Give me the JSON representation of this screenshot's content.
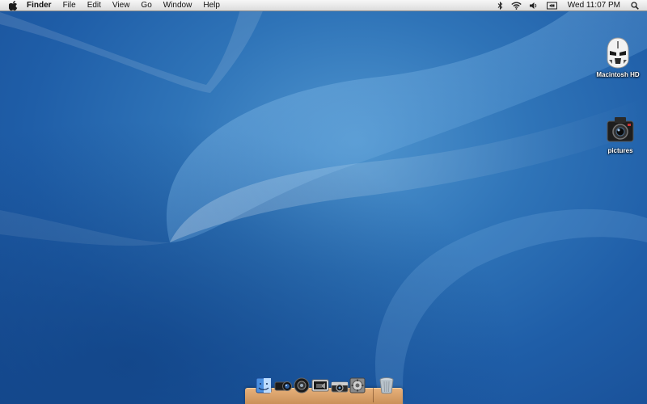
{
  "menubar": {
    "apple_icon": "apple-logo-icon",
    "app_name": "Finder",
    "items": [
      "File",
      "Edit",
      "View",
      "Go",
      "Window",
      "Help"
    ],
    "status_icons": [
      "bluetooth-icon",
      "wifi-icon",
      "volume-icon",
      "display-mirroring-icon"
    ],
    "clock": "Wed 11:07 PM",
    "search_icon": "spotlight-search-icon"
  },
  "desktop": {
    "icons": [
      {
        "label": "Macintosh HD",
        "icon": "clone-trooper-helmet-icon"
      },
      {
        "label": "pictures",
        "icon": "camera-icon"
      }
    ]
  },
  "dock": {
    "items": [
      {
        "name": "finder",
        "icon": "finder-icon"
      },
      {
        "name": "camera-lens",
        "icon": "camera-lens-icon"
      },
      {
        "name": "speaker",
        "icon": "speaker-icon"
      },
      {
        "name": "video",
        "icon": "video-icon"
      },
      {
        "name": "camera",
        "icon": "camera-icon"
      },
      {
        "name": "preferences",
        "icon": "system-preferences-icon"
      },
      {
        "name": "trash",
        "icon": "trash-icon"
      }
    ]
  },
  "colors": {
    "wallpaper_base": "#1f5ea8",
    "menubar": "#e8e8e8",
    "dock_shelf": "#d89c63"
  }
}
